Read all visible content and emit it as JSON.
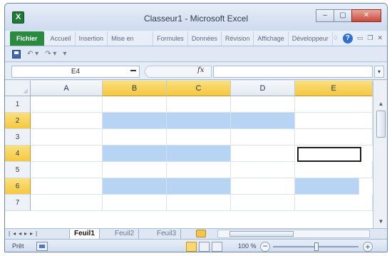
{
  "window": {
    "title": "Classeur1 - Microsoft Excel",
    "app_icon": "excel-icon"
  },
  "title_buttons": {
    "minimize": "–",
    "maximize": "▢",
    "close": "✕"
  },
  "ribbon": {
    "file_tab": "Fichier",
    "tabs": [
      "Accueil",
      "Insertion",
      "Mise en page",
      "Formules",
      "Données",
      "Révision",
      "Affichage",
      "Développeur"
    ]
  },
  "namebox": {
    "value": "E4"
  },
  "formula_bar": {
    "fx_label": "fx",
    "value": ""
  },
  "columns": [
    "A",
    "B",
    "C",
    "D",
    "E"
  ],
  "selected_columns": [
    "B",
    "C",
    "E"
  ],
  "rows": [
    "1",
    "2",
    "3",
    "4",
    "5",
    "6",
    "7"
  ],
  "selected_rows": [
    "2",
    "4",
    "6"
  ],
  "highlight_color": "#b8d4f4",
  "header_highlight_color": "#f5c842",
  "sheet_tabs": [
    "Feuil1",
    "Feuil2",
    "Feuil3"
  ],
  "active_sheet": "Feuil1",
  "status": {
    "ready": "Prêt",
    "zoom": "100 %"
  }
}
